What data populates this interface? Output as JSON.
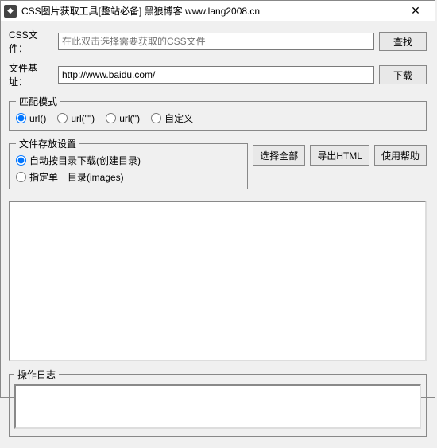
{
  "window": {
    "title": "CSS图片获取工具[整站必备] 黑狼博客 www.lang2008.cn",
    "icon_glyph": "◆"
  },
  "form": {
    "css_label": "CSS文件：",
    "css_placeholder": "在此双击选择需要获取的CSS文件",
    "css_value": "",
    "find_btn": "查找",
    "base_label": "文件基址：",
    "base_value": "http://www.baidu.com/",
    "download_btn": "下载"
  },
  "pattern": {
    "legend": "匹配模式",
    "options": [
      "url()",
      "url(\"\")",
      "url('')",
      "自定义"
    ],
    "selected": 0
  },
  "storage": {
    "legend": "文件存放设置",
    "options": [
      "自动按目录下载(创建目录)",
      "指定单一目录(images)"
    ],
    "selected": 0
  },
  "actions": {
    "select_all": "选择全部",
    "export_html": "导出HTML",
    "help": "使用帮助"
  },
  "log": {
    "legend": "操作日志",
    "content": ""
  }
}
